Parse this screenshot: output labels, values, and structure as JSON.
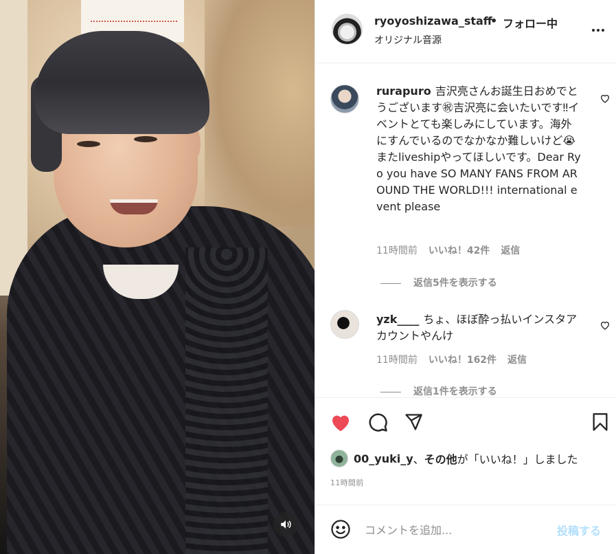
{
  "header": {
    "username": "ryoyoshizawa_staff",
    "separator": "•",
    "follow_status": "フォロー中",
    "audio": "オリジナル音源",
    "more_icon": "more-horizontal-icon"
  },
  "comments": [
    {
      "username": "rurapuro",
      "text": "吉沢亮さんお誕生日おめでとうございます㊗吉沢亮に会いたいです‼イベントとても楽しみにしています。海外にすんでいるのでなかなか難しいけど😭またliveshipやってほしいです。Dear Ryo you have SO MANY FANS FROM AROUND THE WORLD!!! international event please",
      "time": "11時間前",
      "likes": "いいね！42件",
      "reply": "返信",
      "view_replies": "返信5件を表示する"
    },
    {
      "username": "yzk____",
      "text": "ちょ、ほぼ酔っ払いインスタアカウントやんけ",
      "time": "11時間前",
      "likes": "いいね！162件",
      "reply": "返信",
      "view_replies": "返信1件を表示する"
    }
  ],
  "actions": {
    "like_icon": "heart-filled-icon",
    "comment_icon": "comment-icon",
    "share_icon": "paper-plane-icon",
    "save_icon": "bookmark-icon",
    "like_color": "#ed4956"
  },
  "likes_summary": {
    "user": "00_yuki_y",
    "separator": "、",
    "others": "その他",
    "suffix": "が「いいね！」しました"
  },
  "post_time": "11時間前",
  "composer": {
    "placeholder": "コメントを追加...",
    "post_label": "投稿する",
    "post_color": "#b2dffc"
  },
  "media": {
    "sound_icon": "speaker-icon"
  }
}
